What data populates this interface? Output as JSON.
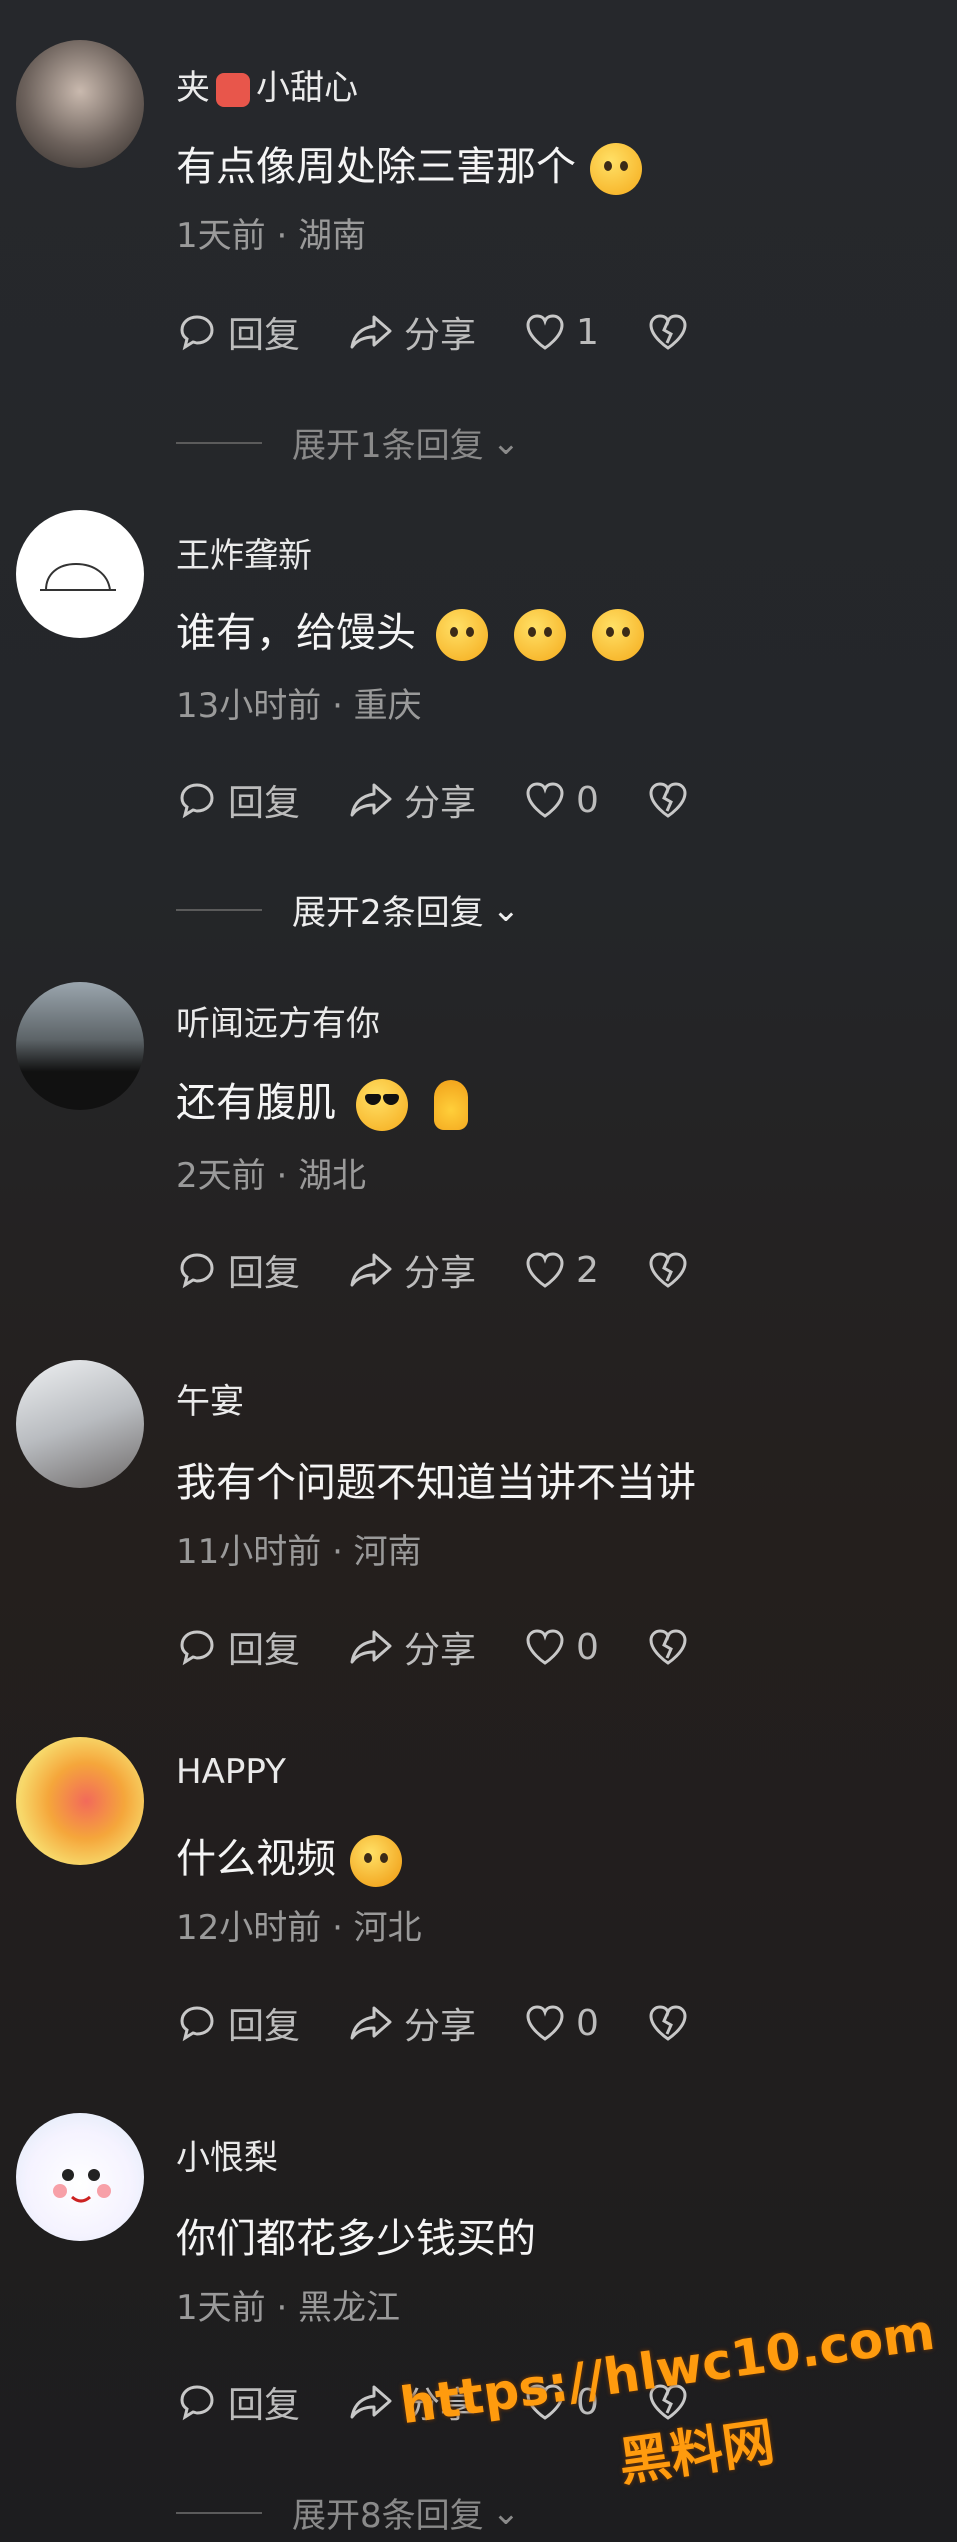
{
  "comments": [
    {
      "name": "夹",
      "name_suffix": "小甜心",
      "text": "有点像周处除三害那个",
      "meta": "1天前 · 湖南",
      "reply": "回复",
      "share": "分享",
      "likes": "1",
      "expand": "展开1条回复"
    },
    {
      "name": "王炸聋新",
      "text": "谁有，给馒头",
      "meta": "13小时前 · 重庆",
      "reply": "回复",
      "share": "分享",
      "likes": "0",
      "expand": "展开2条回复"
    },
    {
      "name": "听闻远方有你",
      "text": "还有腹肌",
      "meta": "2天前 · 湖北",
      "reply": "回复",
      "share": "分享",
      "likes": "2"
    },
    {
      "name": "午宴",
      "text": "我有个问题不知道当讲不当讲",
      "meta": "11小时前 · 河南",
      "reply": "回复",
      "share": "分享",
      "likes": "0"
    },
    {
      "name": "HAPPY",
      "text": "什么视频",
      "meta": "12小时前 · 河北",
      "reply": "回复",
      "share": "分享",
      "likes": "0"
    },
    {
      "name": "小恨梨",
      "text": "你们都花多少钱买的",
      "meta": "1天前 · 黑龙江",
      "reply": "回复",
      "share": "分享",
      "likes": "0",
      "expand": "展开8条回复"
    }
  ],
  "watermark": {
    "url": "https://hlwc10.com",
    "brand": "黑料网"
  },
  "colors": {
    "background": "#242629",
    "text": "#f2f2f2",
    "meta": "#9a9a9a",
    "watermark": "#ff9b0e"
  }
}
